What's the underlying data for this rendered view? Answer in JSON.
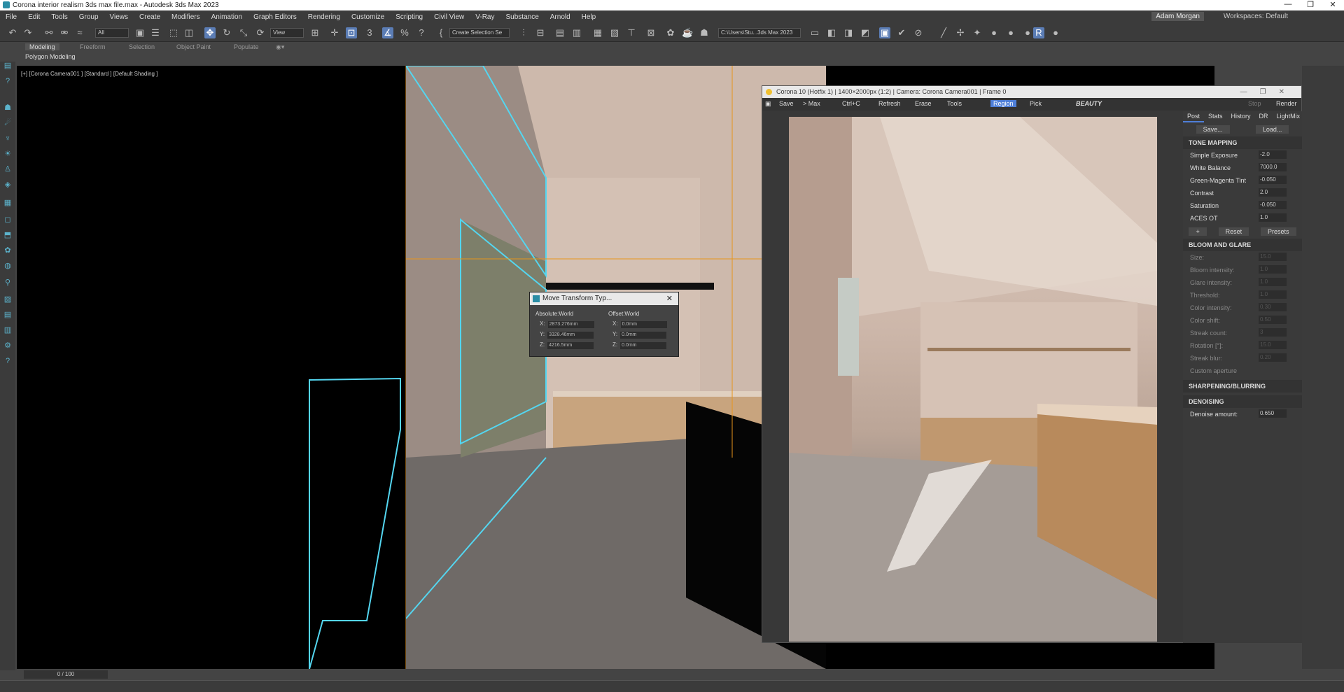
{
  "window": {
    "title": "Corona interior realism 3ds max file.max - Autodesk 3ds Max 2023",
    "minimize": "—",
    "maximize": "❐",
    "close": "✕"
  },
  "menu": {
    "items": [
      "File",
      "Edit",
      "Tools",
      "Group",
      "Views",
      "Create",
      "Modifiers",
      "Animation",
      "Graph Editors",
      "Rendering",
      "Customize",
      "Scripting",
      "Civil View",
      "V-Ray",
      "Substance",
      "Arnold",
      "Help"
    ],
    "user": "Adam Morgan",
    "workspaces": "Workspaces: Default"
  },
  "toolbar": {
    "filter": "All",
    "refcoord": "View",
    "selection_set": "Create Selection Se",
    "path": "C:\\Users\\Stu...3ds Max 2023",
    "icons": [
      "undo-icon",
      "redo-icon",
      "link-icon",
      "unlink-icon",
      "bind-icon",
      "select-icon",
      "select-name-icon",
      "rect-select-icon",
      "window-icon",
      "move-icon",
      "rotate-icon",
      "scale-icon",
      "placement-icon",
      "snap-icon",
      "angle-snap-icon",
      "percent-snap-icon",
      "spinner-snap-icon",
      "edit-named-icon",
      "mirror-icon",
      "align-icon",
      "layer-icon",
      "ribbon-icon",
      "curve-icon",
      "schematic-icon",
      "material-icon",
      "render-setup-icon",
      "render-frame-icon",
      "render-icon",
      "teapot-icon"
    ]
  },
  "ribbon": {
    "tabs": [
      "Modeling",
      "Freeform",
      "Selection",
      "Object Paint",
      "Populate"
    ],
    "active": "Modeling",
    "sub": "Polygon Modeling"
  },
  "viewport": {
    "label": "[+] [Corona Camera001 ] [Standard ] [Default Shading ]"
  },
  "move_dialog": {
    "title": "Move Transform Typ...",
    "absolute": "Absolute:World",
    "offset": "Offset:World",
    "abs_x": "2873.276mm",
    "abs_y": "3328.46mm",
    "abs_z": "4216.5mm",
    "off_x": "0.0mm",
    "off_y": "0.0mm",
    "off_z": "0.0mm"
  },
  "render_window": {
    "title": "Corona 10 (Hotfix 1) | 1400×2000px (1:2) | Camera: Corona Camera001 | Frame 0",
    "tools": [
      "Save",
      "> Max",
      "Ctrl+C",
      "Refresh",
      "Erase",
      "Tools",
      "Region",
      "Pick"
    ],
    "channel": "BEAUTY",
    "stop": "Stop",
    "render": "Render",
    "tabs": [
      "Post",
      "Stats",
      "History",
      "DR",
      "LightMix"
    ],
    "save": "Save...",
    "load": "Load...",
    "tone_mapping": "TONE MAPPING",
    "tone_rows": [
      {
        "label": "Simple Exposure",
        "value": "-2.0"
      },
      {
        "label": "White Balance",
        "value": "7000.0"
      },
      {
        "label": "Green-Magenta Tint",
        "value": "-0.050"
      },
      {
        "label": "Contrast",
        "value": "2.0"
      },
      {
        "label": "Saturation",
        "value": "-0.050"
      },
      {
        "label": "ACES OT",
        "value": "1.0"
      }
    ],
    "reset": "Reset",
    "presets": "Presets",
    "bloom": "BLOOM AND GLARE",
    "bloom_rows": [
      {
        "label": "Size:",
        "value": "15.0"
      },
      {
        "label": "Bloom intensity:",
        "value": "1.0"
      },
      {
        "label": "Glare intensity:",
        "value": "1.0"
      },
      {
        "label": "Threshold:",
        "value": "1.0"
      },
      {
        "label": "Color intensity:",
        "value": "0.30"
      },
      {
        "label": "Color shift:",
        "value": "0.50"
      },
      {
        "label": "Streak count:",
        "value": "3"
      },
      {
        "label": "Rotation [°]:",
        "value": "15.0"
      },
      {
        "label": "Streak blur:",
        "value": "0.20"
      }
    ],
    "custom_aperture": "Custom aperture",
    "sharpening": "SHARPENING/BLURRING",
    "denoising": "DENOISING",
    "denoise_label": "Denoise amount:",
    "denoise_value": "0.650"
  },
  "timeline": {
    "frame": "0 / 100"
  },
  "colors": {
    "accent": "#5b7db5",
    "highlight_cyan": "#54d6f0",
    "frame_orange": "#e8951a"
  }
}
